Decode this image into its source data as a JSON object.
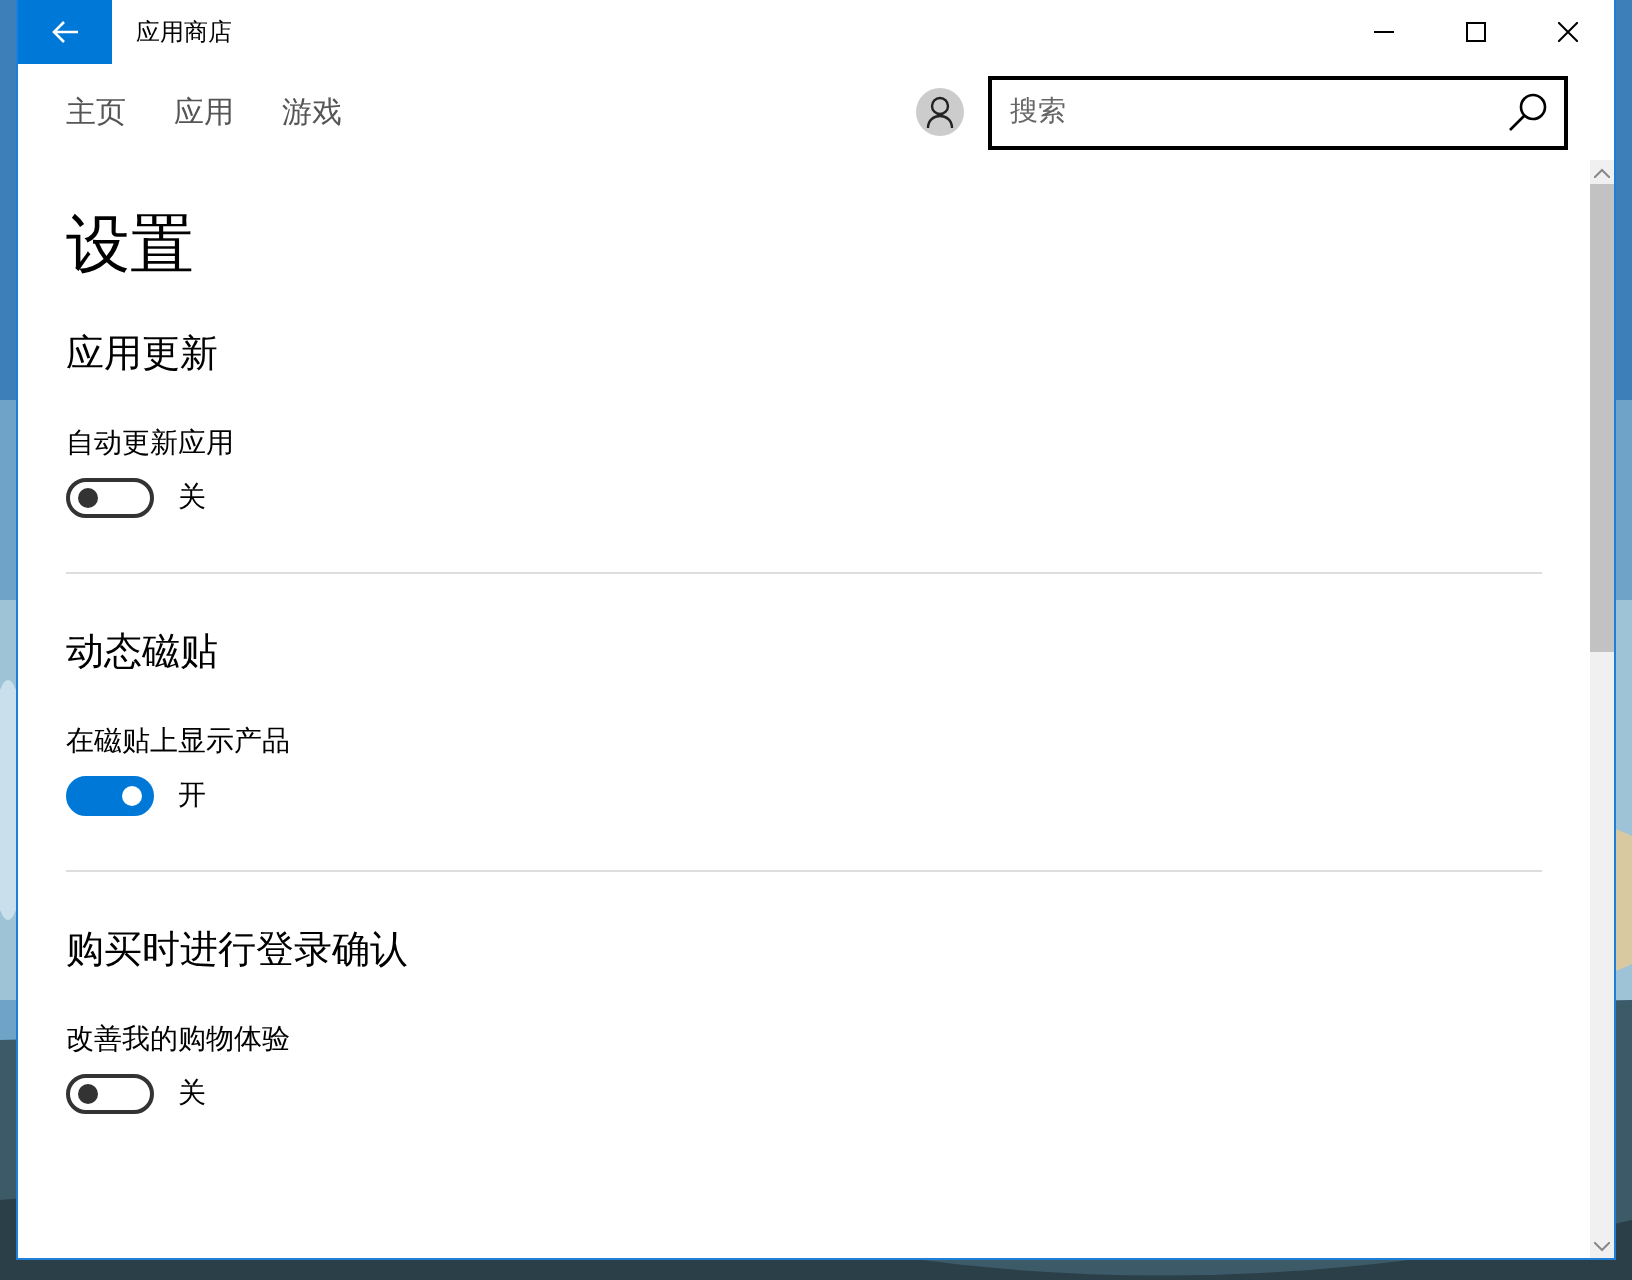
{
  "window": {
    "title": "应用商店"
  },
  "nav": [
    {
      "label": "主页",
      "selected": false
    },
    {
      "label": "应用",
      "selected": false
    },
    {
      "label": "游戏",
      "selected": false
    }
  ],
  "search": {
    "placeholder": "搜索"
  },
  "page_title": "设置",
  "sections": [
    {
      "title": "应用更新",
      "setting": "自动更新应用",
      "on": false,
      "state_label": "关"
    },
    {
      "title": "动态磁贴",
      "setting": "在磁贴上显示产品",
      "on": true,
      "state_label": "开"
    },
    {
      "title": "购买时进行登录确认",
      "setting": "改善我的购物体验",
      "on": false,
      "state_label": "关"
    }
  ]
}
